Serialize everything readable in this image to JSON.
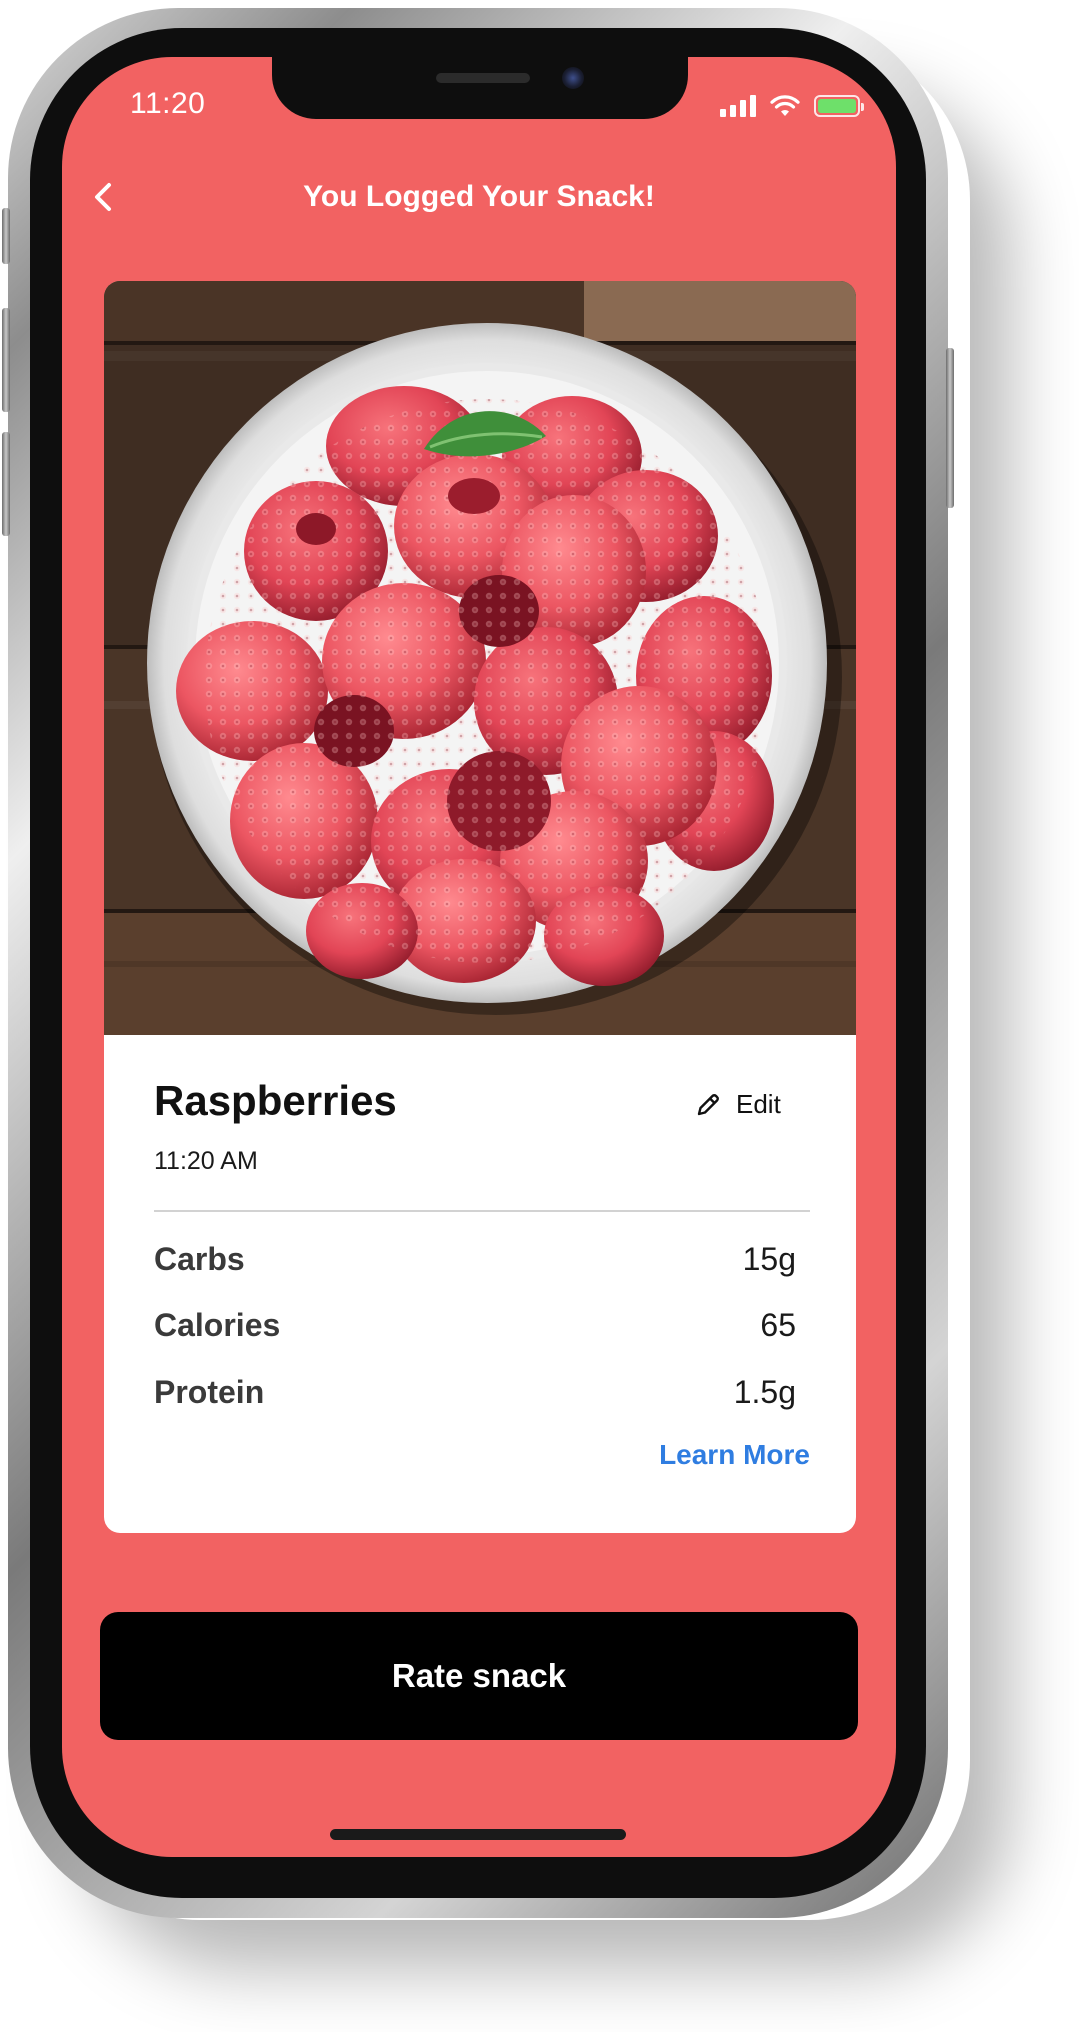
{
  "status_bar": {
    "time": "11:20"
  },
  "header": {
    "title": "You Logged Your Snack!",
    "back_icon": "chevron-left-icon"
  },
  "snack": {
    "name": "Raspberries",
    "time": "11:20 AM",
    "edit_label": "Edit",
    "edit_icon": "pencil-icon",
    "photo": "raspberries-bowl-photo",
    "nutrients": [
      {
        "label": "Carbs",
        "value": "15g"
      },
      {
        "label": "Calories",
        "value": "65"
      },
      {
        "label": "Protein",
        "value": "1.5g"
      }
    ],
    "learn_more_label": "Learn More"
  },
  "actions": {
    "rate_label": "Rate snack"
  },
  "colors": {
    "screen_background": "#f26262",
    "card_background": "#ffffff",
    "link": "#2f7de1",
    "button": "#000000",
    "battery": "#6ee06a"
  }
}
